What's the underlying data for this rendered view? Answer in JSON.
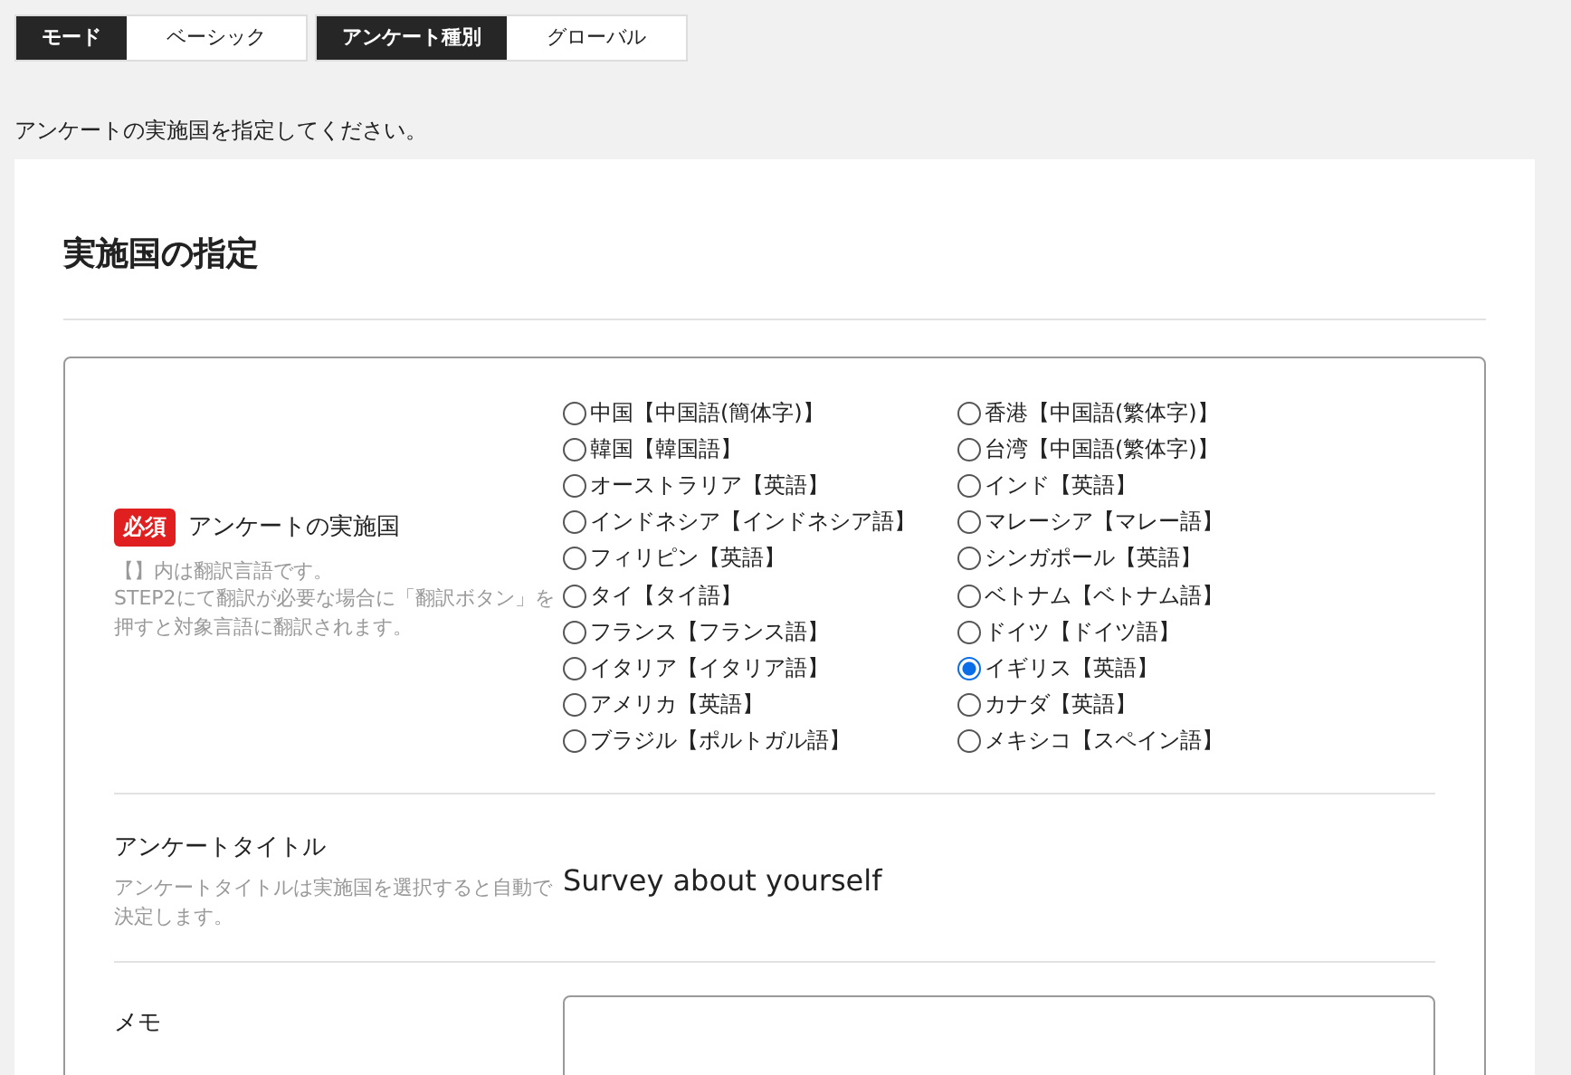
{
  "mode_bar": [
    {
      "label": "モード",
      "value": "ベーシック"
    },
    {
      "label": "アンケート種別",
      "value": "グローバル"
    }
  ],
  "instruction": "アンケートの実施国を指定してください。",
  "card": {
    "title": "実施国の指定",
    "country_field": {
      "required_badge": "必須",
      "label": "アンケートの実施国",
      "help": [
        "【】内は翻訳言語です。",
        "STEP2にて翻訳が必要な場合に「翻訳ボタン」を押すと対象言語に翻訳されます。"
      ],
      "columns": [
        [
          {
            "label": "中国【中国語(簡体字)】",
            "selected": false
          },
          {
            "label": "韓国【韓国語】",
            "selected": false
          },
          {
            "label": "オーストラリア【英語】",
            "selected": false
          },
          {
            "label": "インドネシア【インドネシア語】",
            "selected": false
          },
          {
            "label": "フィリピン【英語】",
            "selected": false
          },
          {
            "label": "タイ【タイ語】",
            "selected": false
          },
          {
            "label": "フランス【フランス語】",
            "selected": false
          },
          {
            "label": "イタリア【イタリア語】",
            "selected": false
          },
          {
            "label": "アメリカ【英語】",
            "selected": false
          },
          {
            "label": "ブラジル【ポルトガル語】",
            "selected": false
          }
        ],
        [
          {
            "label": "香港【中国語(繁体字)】",
            "selected": false
          },
          {
            "label": "台湾【中国語(繁体字)】",
            "selected": false
          },
          {
            "label": "インド【英語】",
            "selected": false
          },
          {
            "label": "マレーシア【マレー語】",
            "selected": false
          },
          {
            "label": "シンガポール【英語】",
            "selected": false
          },
          {
            "label": "ベトナム【ベトナム語】",
            "selected": false
          },
          {
            "label": "ドイツ【ドイツ語】",
            "selected": false
          },
          {
            "label": "イギリス【英語】",
            "selected": true
          },
          {
            "label": "カナダ【英語】",
            "selected": false
          },
          {
            "label": "メキシコ【スペイン語】",
            "selected": false
          }
        ]
      ]
    },
    "title_field": {
      "label": "アンケートタイトル",
      "help": "アンケートタイトルは実施国を選択すると自動で決定します。",
      "value": "Survey about yourself"
    },
    "memo_field": {
      "label": "メモ"
    }
  }
}
